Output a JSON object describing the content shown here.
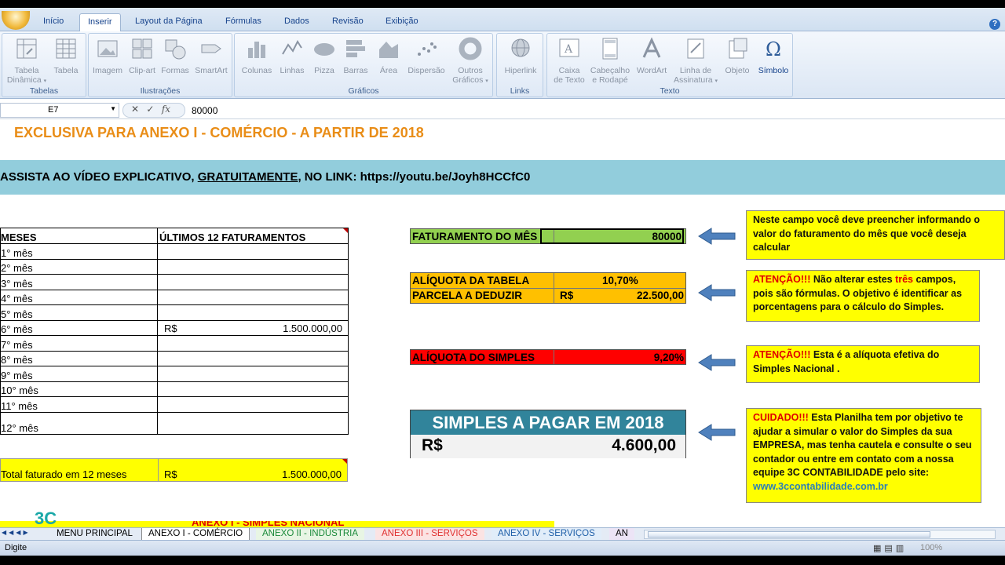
{
  "ribbon": {
    "tabs": [
      "Início",
      "Inserir",
      "Layout da Página",
      "Fórmulas",
      "Dados",
      "Revisão",
      "Exibição"
    ],
    "active_tab": "Inserir",
    "groups": {
      "tabelas": {
        "label": "Tabelas",
        "buttons": [
          {
            "l1": "Tabela",
            "l2": "Dinâmica"
          },
          {
            "l1": "Tabela",
            "l2": ""
          }
        ]
      },
      "ilustracoes": {
        "label": "Ilustrações",
        "buttons": [
          {
            "l1": "Imagem"
          },
          {
            "l1": "Clip-art"
          },
          {
            "l1": "Formas"
          },
          {
            "l1": "SmartArt"
          }
        ]
      },
      "graficos": {
        "label": "Gráficos",
        "buttons": [
          {
            "l1": "Colunas"
          },
          {
            "l1": "Linhas"
          },
          {
            "l1": "Pizza"
          },
          {
            "l1": "Barras"
          },
          {
            "l1": "Área"
          },
          {
            "l1": "Dispersão"
          },
          {
            "l1": "Outros",
            "l2": "Gráficos"
          }
        ]
      },
      "links": {
        "label": "Links",
        "buttons": [
          {
            "l1": "Hiperlink"
          }
        ]
      },
      "texto": {
        "label": "Texto",
        "buttons": [
          {
            "l1": "Caixa",
            "l2": "de Texto"
          },
          {
            "l1": "Cabeçalho",
            "l2": "e Rodapé"
          },
          {
            "l1": "WordArt"
          },
          {
            "l1": "Linha de",
            "l2": "Assinatura"
          },
          {
            "l1": "Objeto"
          },
          {
            "l1": "Símbolo"
          }
        ]
      }
    }
  },
  "formula_bar": {
    "cell": "E7",
    "fx": "fx",
    "value": "80000"
  },
  "sheet": {
    "title": "EXCLUSIVA PARA ANEXO I - COMÉRCIO - A PARTIR DE 2018",
    "band": {
      "before": "ASSISTA AO VÍDEO EXPLICATIVO, ",
      "underlined": "GRATUITAMENTE",
      "after": ", NO LINK: https://youtu.be/Joyh8HCCfC0"
    },
    "table": {
      "col1": "MESES",
      "col2": "ÚLTIMOS 12 FATURAMENTOS",
      "rows": [
        {
          "mes": "1° mês",
          "rs": "",
          "valor": ""
        },
        {
          "mes": "2° mês",
          "rs": "",
          "valor": ""
        },
        {
          "mes": "3° mês",
          "rs": "",
          "valor": ""
        },
        {
          "mes": "4° mês",
          "rs": "",
          "valor": ""
        },
        {
          "mes": "5° mês",
          "rs": "",
          "valor": ""
        },
        {
          "mes": "6° mês",
          "rs": "R$",
          "valor": "1.500.000,00"
        },
        {
          "mes": "7° mês",
          "rs": "",
          "valor": ""
        },
        {
          "mes": "8° mês",
          "rs": "",
          "valor": ""
        },
        {
          "mes": "9° mês",
          "rs": "",
          "valor": ""
        },
        {
          "mes": "10° mês",
          "rs": "",
          "valor": ""
        },
        {
          "mes": "11° mês",
          "rs": "",
          "valor": ""
        },
        {
          "mes": "12° mês",
          "rs": "",
          "valor": ""
        }
      ]
    },
    "total": {
      "label": "Total faturado em 12 meses",
      "rs": "R$",
      "value": "1.500.000,00"
    },
    "faturamento": {
      "label": "FATURAMENTO DO MÊS",
      "value": "80000"
    },
    "aliquota_tabela": {
      "label": "ALÍQUOTA DA TABELA",
      "value": "10,70%"
    },
    "parcela": {
      "label": "PARCELA A DEDUZIR",
      "rs": "R$",
      "value": "22.500,00"
    },
    "aliquota_simples": {
      "label": "ALÍQUOTA DO SIMPLES",
      "value": "9,20%"
    },
    "simples": {
      "title": "SIMPLES A PAGAR EM 2018",
      "rs": "R$",
      "value": "4.600,00"
    },
    "notes": {
      "n1": "Neste campo você deve preencher informando o valor do faturamento do mês que você deseja calcular",
      "n2_red": "ATENÇÃO!!!",
      "n2_a": " Não alterar estes ",
      "n2_red2": "três",
      "n2_b": " campos, pois são fórmulas. O objetivo é identificar as porcentagens para o cálculo do Simples.",
      "n3_red": "ATENÇÃO!!!",
      "n3": " Esta é a alíquota efetiva do Simples Nacional .",
      "n4_red": "CUIDADO!!!",
      "n4": " Esta Planilha tem por objetivo te ajudar a simular o valor do Simples da sua EMPRESA, mas tenha cautela e consulte o seu contador ou entre em contato com a nossa equipe 3C CONTABILIDADE pelo site:",
      "n4_link": "www.3ccontabilidade.com.br"
    },
    "partial_text": "ANEXO I - SIMPLES NACIONAL",
    "logo": "3C"
  },
  "sheet_tabs": [
    "MENU PRINCIPAL",
    "ANEXO I - COMÉRCIO",
    "ANEXO II - INDÚSTRIA",
    "ANEXO III - SERVIÇOS",
    "ANEXO IV - SERVIÇOS",
    "AN"
  ],
  "status": {
    "text": "Digite",
    "zoom": "100%"
  },
  "colors": {
    "green": "#92d050",
    "orange": "#ffc000",
    "red": "#ff0000",
    "teal": "#31849b",
    "yellow": "#ffff00",
    "band": "#92cddc"
  }
}
